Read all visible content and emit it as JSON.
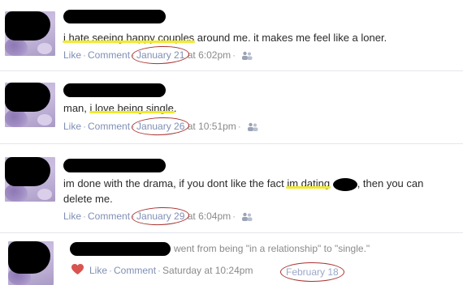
{
  "posts": [
    {
      "text_parts": [
        "",
        "i hate seeing happy couples",
        " around me. it makes me feel like a loner."
      ],
      "actions": {
        "like": "Like",
        "comment": "Comment"
      },
      "date": "January 21",
      "time": "at 6:02pm",
      "audience_icon": "people-icon"
    },
    {
      "text_parts": [
        "man, ",
        "i love being single",
        "."
      ],
      "actions": {
        "like": "Like",
        "comment": "Comment"
      },
      "date": "January 26",
      "time": "at 10:51pm",
      "audience_icon": "people-icon"
    },
    {
      "text_before": "im done with the drama, if you dont like the fact ",
      "highlight": "im dating",
      "text_after_line1": ", then you can",
      "text_line2": "delete me.",
      "actions": {
        "like": "Like",
        "comment": "Comment"
      },
      "date": "January 29",
      "time": "at 6:04pm",
      "audience_icon": "people-icon"
    },
    {
      "story": "went from being \"in a relationship\" to \"single.\"",
      "actions": {
        "like": "Like",
        "comment": "Comment"
      },
      "time": "Saturday at 10:24pm",
      "annotation": "February 18",
      "icon": "heart-icon"
    }
  ],
  "colors": {
    "link": "#7f8fb5",
    "highlight": "#f2ea2a",
    "annotation_circle": "#a8322f",
    "heart": "#d9534f"
  }
}
